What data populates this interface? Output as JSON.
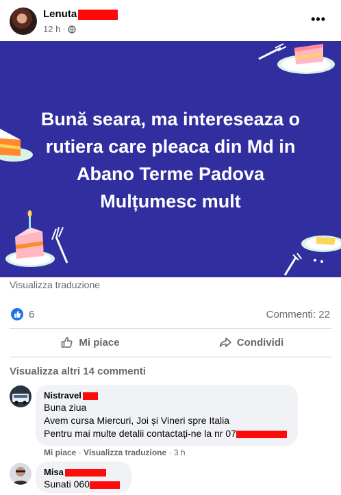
{
  "post": {
    "author": "Lenuta",
    "time": "12 h",
    "time_separator": "·",
    "more_label": "•••",
    "banner_text": [
      "Bună seara, ma intereseaza o",
      "rutiera care pleaca din Md in",
      "Abano Terme Padova",
      "Mulțumesc mult"
    ],
    "banner_color": "#312fa0",
    "translate_label": "Visualizza traduzione"
  },
  "stats": {
    "reactions": "6",
    "comments": "Commenti: 22",
    "reaction_icon": "thumbs-up-icon",
    "reaction_color": "#1b74e4"
  },
  "actions": {
    "like_label": "Mi piace",
    "share_label": "Condividi"
  },
  "comments_section": {
    "view_more": "Visualizza altri 14 commenti",
    "items": [
      {
        "name": "Nistravel",
        "lines": [
          "Buna ziua",
          "Avem cursa Miercuri, Joi și Vineri spre Italia",
          "Pentru mai multe detalii contactați-ne la nr 07"
        ],
        "like": "Mi piace",
        "translate": "Visualizza traduzione",
        "time": "3 h",
        "sep": "·"
      },
      {
        "name": "Misa",
        "lines": [
          "Sunati 060"
        ]
      }
    ]
  }
}
